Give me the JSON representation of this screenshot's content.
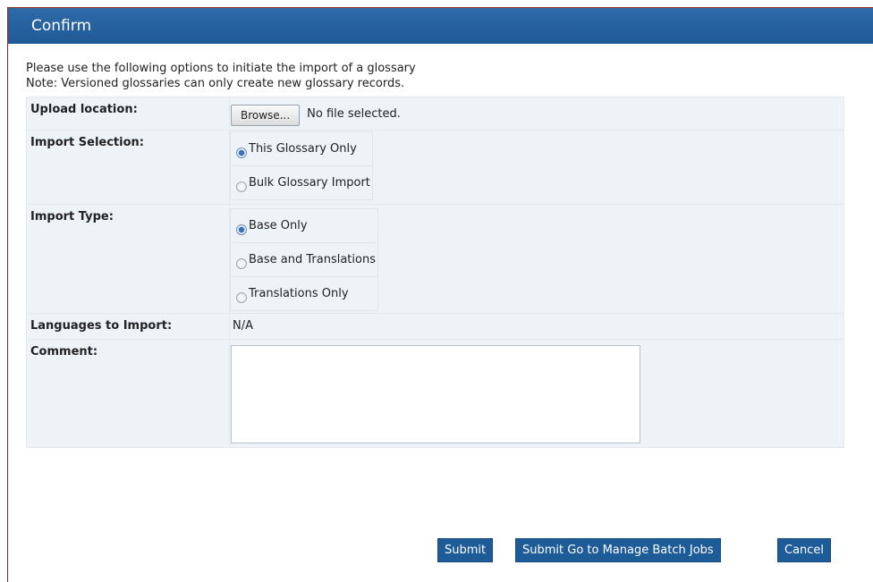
{
  "dialog": {
    "title": "Confirm"
  },
  "intro": {
    "line1": "Please use the following options to initiate the import of a glossary",
    "line2": "Note: Versioned glossaries can only create new glossary records."
  },
  "form": {
    "upload_label": "Upload location:",
    "browse_label": "Browse...",
    "file_status": "No file selected.",
    "import_selection_label": "Import Selection:",
    "import_selection_options": [
      "This Glossary Only",
      "Bulk Glossary Import"
    ],
    "import_selection_selected": "This Glossary Only",
    "import_type_label": "Import Type:",
    "import_type_options": [
      "Base Only",
      "Base and Translations",
      "Translations Only"
    ],
    "import_type_selected": "Base Only",
    "languages_label": "Languages to Import:",
    "languages_value": "N/A",
    "comment_label": "Comment:",
    "comment_value": ""
  },
  "buttons": {
    "submit": "Submit",
    "submit_manage": "Submit Go to Manage Batch Jobs",
    "cancel": "Cancel"
  }
}
